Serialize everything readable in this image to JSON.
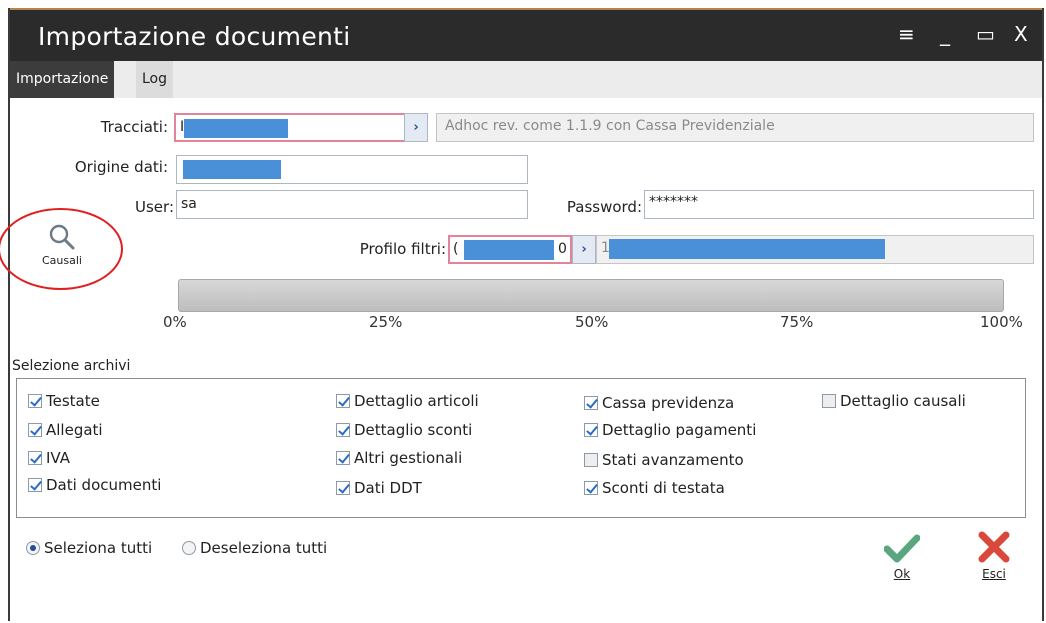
{
  "window": {
    "title": "Importazione documenti",
    "controls": {
      "menu": "≡",
      "minimize": "_",
      "maximize": "▭",
      "close": "X"
    }
  },
  "tabs": [
    {
      "label": "Importazione",
      "active": true
    },
    {
      "label": "Log",
      "active": false
    }
  ],
  "form": {
    "tracciati_label": "Tracciati:",
    "tracciati_value": "Ⅰ",
    "tracciati_desc": "Adhoc rev. come 1.1.9 con Cassa Previdenziale",
    "origine_label": "Origine dati:",
    "user_label": "User:",
    "user_value": "sa",
    "password_label": "Password:",
    "password_value": "*******",
    "profilo_label": "Profilo filtri:",
    "profilo_prefix": "(",
    "profilo_suffix": "0",
    "profilo_desc_prefix": "1"
  },
  "causali_button": {
    "label": "Causali",
    "icon": "magnifier-icon"
  },
  "progress": {
    "value": 0,
    "ticks": [
      "0%",
      "25%",
      "50%",
      "75%",
      "100%"
    ]
  },
  "archivi": {
    "title": "Selezione archivi",
    "columns": [
      [
        {
          "label": "Testate",
          "checked": true
        },
        {
          "label": "Allegati",
          "checked": true
        },
        {
          "label": "IVA",
          "checked": true
        },
        {
          "label": "Dati documenti",
          "checked": true
        }
      ],
      [
        {
          "label": "Dettaglio articoli",
          "checked": true
        },
        {
          "label": "Dettaglio sconti",
          "checked": true
        },
        {
          "label": "Altri gestionali",
          "checked": true
        },
        {
          "label": "Dati DDT",
          "checked": true
        }
      ],
      [
        {
          "label": "Cassa previdenza",
          "checked": true
        },
        {
          "label": "Dettaglio pagamenti",
          "checked": true
        },
        {
          "label": "Stati avanzamento",
          "checked": false
        },
        {
          "label": "Sconti di testata",
          "checked": true
        }
      ],
      [
        {
          "label": "Dettaglio causali",
          "checked": false
        }
      ]
    ]
  },
  "selection": {
    "select_all": "Seleziona tutti",
    "deselect_all": "Deseleziona tutti",
    "selected": "select_all"
  },
  "actions": {
    "ok_label": "Ok",
    "esci_label": "Esci"
  },
  "colors": {
    "titlebar": "#2b2b2b",
    "mask": "#4a90d9",
    "ok": "#5aa77f",
    "esci": "#d9483b",
    "annotation": "#e02020"
  }
}
